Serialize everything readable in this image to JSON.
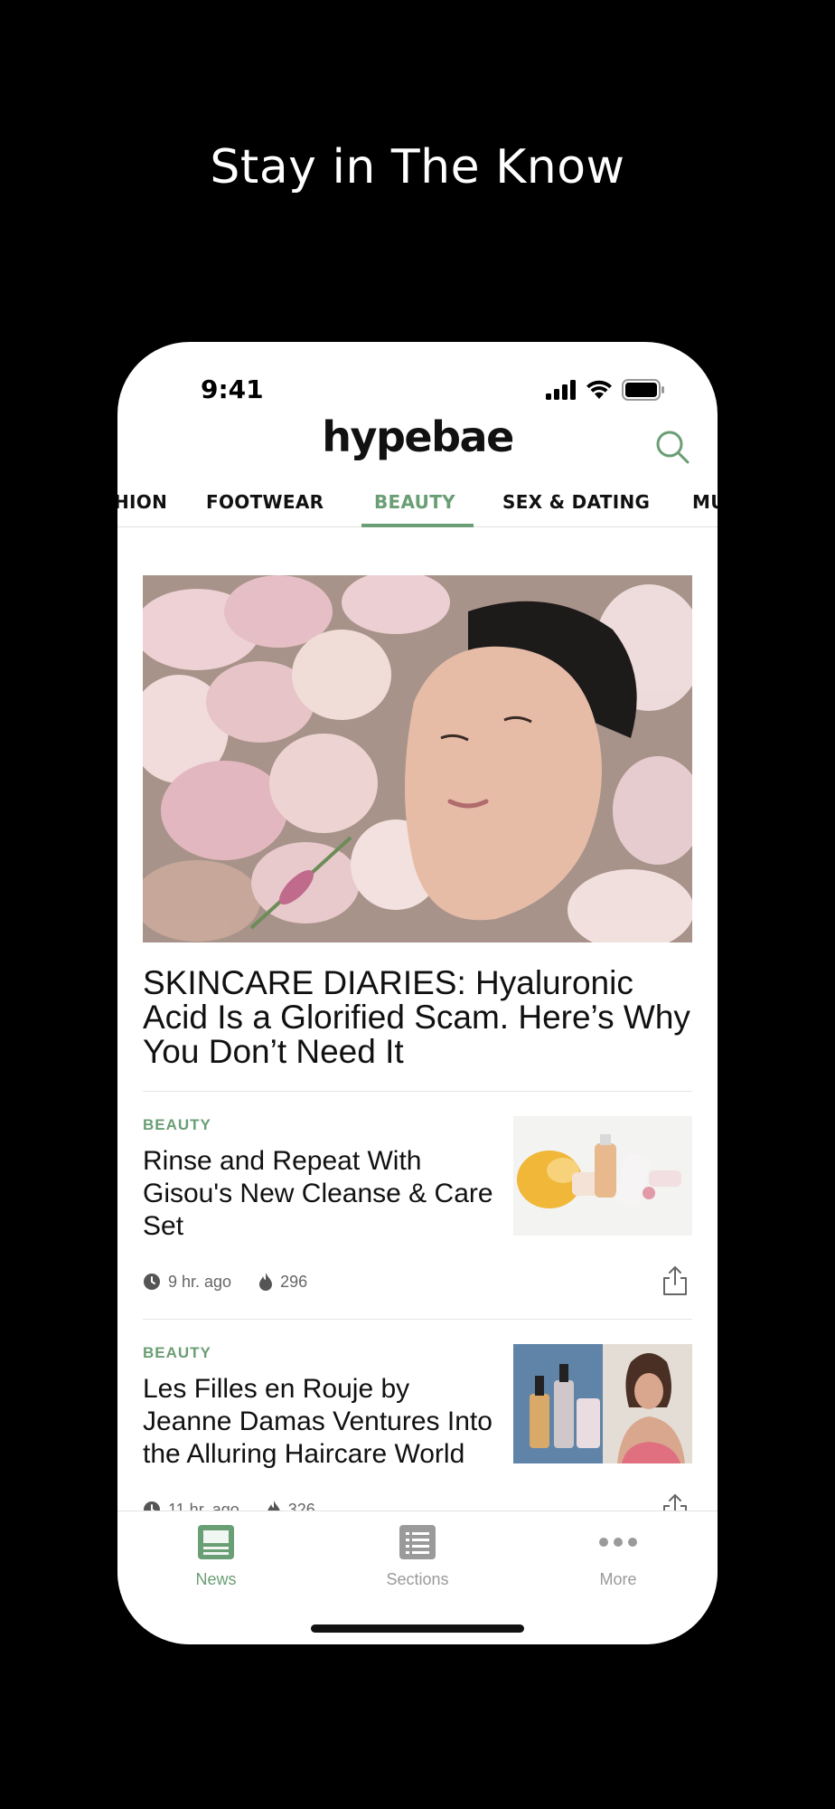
{
  "promo": {
    "headline": "Stay in The Know"
  },
  "status_bar": {
    "time": "9:41"
  },
  "header": {
    "logo": "hypebae"
  },
  "tabs": [
    {
      "label": "HION"
    },
    {
      "label": "FOOTWEAR"
    },
    {
      "label": "BEAUTY",
      "active": true
    },
    {
      "label": "SEX & DATING"
    },
    {
      "label": "MU"
    }
  ],
  "hero": {
    "title": "SKINCARE DIARIES: Hyaluronic Acid Is a Glorified Scam. Here’s Why You Don’t Need It"
  },
  "articles": [
    {
      "category": "BEAUTY",
      "title": "Rinse and Repeat With Gisou's New Cleanse & Care Set",
      "time": "9 hr. ago",
      "views": "296"
    },
    {
      "category": "BEAUTY",
      "title": "Les Filles en Rouje by Jeanne Damas Ventures Into the Alluring Haircare World",
      "time": "11 hr. ago",
      "views": "326"
    }
  ],
  "bottom_nav": [
    {
      "label": "News",
      "active": true,
      "icon": "newspaper-icon"
    },
    {
      "label": "Sections",
      "icon": "list-icon"
    },
    {
      "label": "More",
      "icon": "more-dots-icon"
    }
  ],
  "colors": {
    "accent": "#6a9e74",
    "background": "#000000"
  }
}
